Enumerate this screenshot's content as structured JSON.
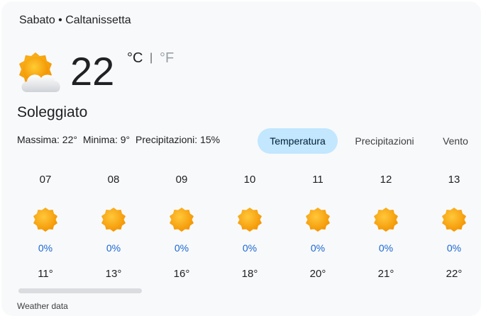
{
  "header": {
    "text": "Sabato • Caltanissetta"
  },
  "current": {
    "icon": "partly-sunny-icon",
    "temperature": "22",
    "unit_c": "°C",
    "unit_sep": "|",
    "unit_f": "°F",
    "condition": "Soleggiato"
  },
  "stats": {
    "max": "Massima: 22°",
    "min": "Minima: 9°",
    "precip": "Precipitazioni: 15%"
  },
  "tabs": [
    {
      "label": "Temperatura",
      "active": true
    },
    {
      "label": "Precipitazioni",
      "active": false
    },
    {
      "label": "Vento",
      "active": false
    }
  ],
  "hours": [
    {
      "time": "07",
      "icon": "sun-icon",
      "precip": "0%",
      "temp": "11°"
    },
    {
      "time": "08",
      "icon": "sun-icon",
      "precip": "0%",
      "temp": "13°"
    },
    {
      "time": "09",
      "icon": "sun-icon",
      "precip": "0%",
      "temp": "16°"
    },
    {
      "time": "10",
      "icon": "sun-icon",
      "precip": "0%",
      "temp": "18°"
    },
    {
      "time": "11",
      "icon": "sun-icon",
      "precip": "0%",
      "temp": "20°"
    },
    {
      "time": "12",
      "icon": "sun-icon",
      "precip": "0%",
      "temp": "21°"
    },
    {
      "time": "13",
      "icon": "sun-icon",
      "precip": "0%",
      "temp": "22°"
    }
  ],
  "footer": {
    "text": "Weather data"
  },
  "colors": {
    "accent_tab": "#c2e7ff",
    "precip_text": "#1967d2",
    "sun": "#f9a825"
  }
}
